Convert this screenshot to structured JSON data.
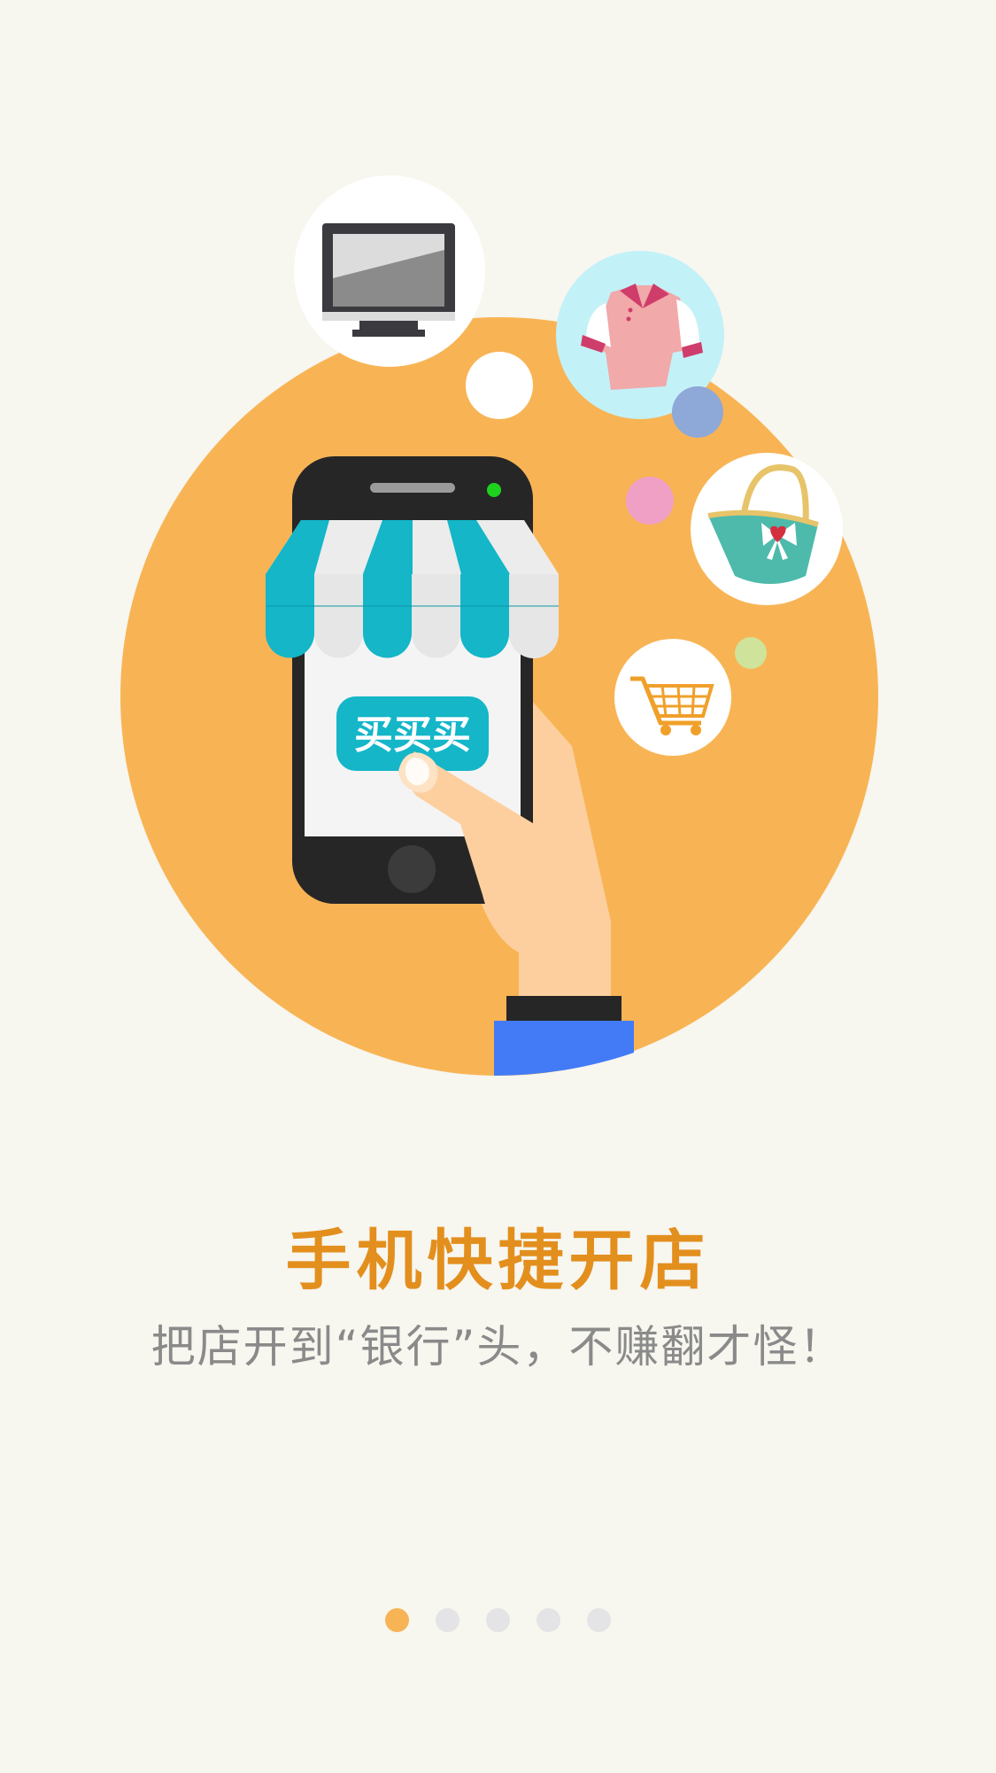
{
  "illustration": {
    "buy_button_label": "买买买",
    "icons": [
      "monitor-icon",
      "shirt-icon",
      "handbag-icon",
      "shopping-cart-icon"
    ],
    "colors": {
      "circle": "#f8b454",
      "awning_teal": "#14b6c8",
      "awning_white": "#ececec",
      "phone": "#262626",
      "hand": "#fdcf9f",
      "sleeve": "#437bf6"
    }
  },
  "onboarding": {
    "title": "手机快捷开店",
    "subtitle": "把店开到“银行”头，不赚翻才怪！",
    "current_page": 1,
    "total_pages": 5
  },
  "page_indicator": {
    "active_color": "#f7b454",
    "inactive_color": "#e4e4e6"
  }
}
